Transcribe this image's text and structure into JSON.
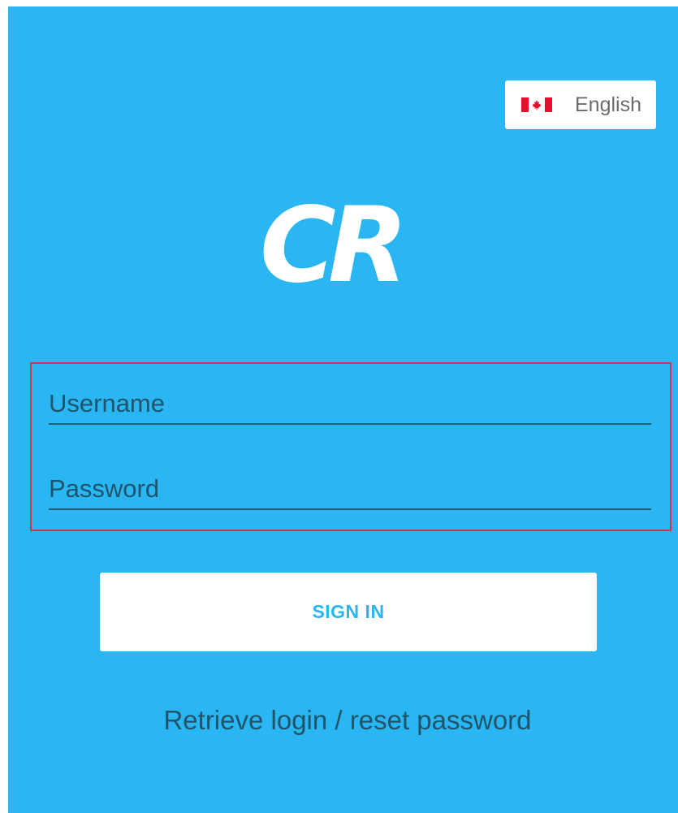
{
  "language_selector": {
    "label": "English",
    "flag_icon": "canada-flag-icon",
    "flag_colors": {
      "red": "#e8112d",
      "white": "#ffffff"
    }
  },
  "logo": {
    "text": "CR"
  },
  "login_form": {
    "username_placeholder": "Username",
    "password_placeholder": "Password",
    "highlight_border_color": "#d8324a"
  },
  "actions": {
    "sign_in_label": "SIGN IN",
    "retrieve_link": "Retrieve login / reset password"
  },
  "colors": {
    "background": "#29b6f3",
    "field_text": "#20546b",
    "button_bg": "#ffffff"
  }
}
